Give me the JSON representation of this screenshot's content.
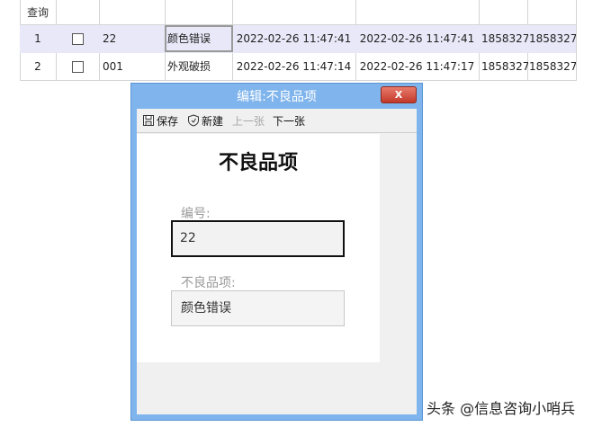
{
  "table": {
    "query_label": "查询",
    "rows": [
      {
        "index": "1",
        "code": "22",
        "name": "颜色错误",
        "created": "2022-02-26 11:47:41",
        "modified": "2022-02-26 11:47:41",
        "user1": "1858327",
        "user2": "1858327"
      },
      {
        "index": "2",
        "code": "001",
        "name": "外观破损",
        "created": "2022-02-26 11:47:14",
        "modified": "2022-02-26 11:47:17",
        "user1": "1858327",
        "user2": "1858327"
      }
    ]
  },
  "dialog": {
    "title": "编辑:不良品项",
    "close_label": "X",
    "toolbar": {
      "save": "保存",
      "new": "新建",
      "prev": "上一张",
      "next": "下一张"
    },
    "form_title": "不良品项",
    "fields": {
      "code_label": "编号:",
      "code_value": "22",
      "name_label": "不良品项:",
      "name_value": "颜色错误"
    }
  },
  "watermark": "头条 @信息咨询小哨兵",
  "colors": {
    "dialog_frame": "#7fb4ec",
    "close_button": "#d24b3b",
    "selected_row": "#e8e8f8"
  }
}
